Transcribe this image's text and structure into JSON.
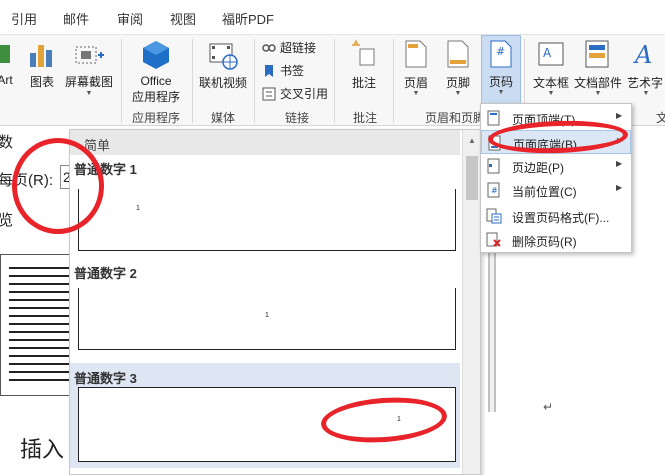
{
  "tabs": [
    "引用",
    "邮件",
    "审阅",
    "视图",
    "福昕PDF"
  ],
  "ribbon": {
    "smartart_fragment": "tArt",
    "chart": "图表",
    "screenshot": "屏幕截图",
    "office_apps_line1": "Office",
    "office_apps_line2": "应用程序",
    "online_video": "联机视频",
    "hyperlink": "超链接",
    "bookmark": "书签",
    "cross_ref": "交叉引用",
    "comment": "批注",
    "header": "页眉",
    "footer": "页脚",
    "page_number": "页码",
    "textbox": "文本框",
    "quick_parts": "文档部件",
    "wordart": "艺术字",
    "groups": {
      "apps": "应用程序",
      "media": "媒体",
      "links": "链接",
      "comments": "批注",
      "header_footer": "页眉和页脚",
      "text_fragment": "文"
    }
  },
  "dialog_fragment": {
    "line1": "数",
    "line2": "每页(R):",
    "line2_value": "2",
    "line3": "览"
  },
  "document": {
    "insert_text": "插入",
    "return_mark": "↵"
  },
  "gallery": {
    "header": "简单",
    "items": [
      {
        "title": "普通数字 1",
        "num": "1",
        "align": "left"
      },
      {
        "title": "普通数字 2",
        "num": "1",
        "align": "center"
      },
      {
        "title": "普通数字 3",
        "num": "1",
        "align": "right"
      }
    ]
  },
  "menu": {
    "items": [
      {
        "label": "页面顶端(T)",
        "submenu": true,
        "icon": "page-top-icon"
      },
      {
        "label": "页面底端(B)",
        "submenu": true,
        "icon": "page-bottom-icon",
        "highlighted": true
      },
      {
        "label": "页边距(P)",
        "submenu": true,
        "icon": "page-margin-icon"
      },
      {
        "label": "当前位置(C)",
        "submenu": true,
        "icon": "current-position-icon"
      },
      {
        "label": "设置页码格式(F)...",
        "submenu": false,
        "icon": "format-page-number-icon"
      },
      {
        "label": "删除页码(R)",
        "submenu": false,
        "icon": "remove-page-number-icon"
      }
    ]
  },
  "colors": {
    "annotation_red": "#e8242a",
    "highlight": "#dbe7f4",
    "accent_blue": "#2b6cc4"
  }
}
